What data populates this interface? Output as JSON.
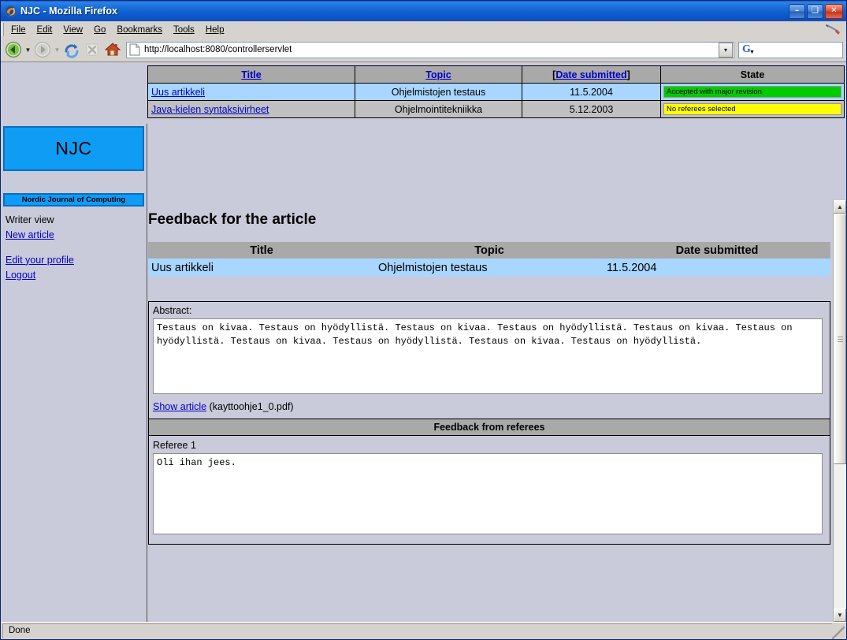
{
  "window": {
    "title": "NJC - Mozilla Firefox",
    "app_icon": "firefox-icon",
    "minimize_label": "–",
    "maximize_label": "❑",
    "close_label": "✕"
  },
  "menu": {
    "items": [
      "File",
      "Edit",
      "View",
      "Go",
      "Bookmarks",
      "Tools",
      "Help"
    ]
  },
  "toolbar": {
    "back_label": "Back",
    "forward_label": "Forward",
    "reload_label": "Reload",
    "stop_label": "Stop",
    "home_label": "Home",
    "url": "http://localhost:8080/controllerservlet",
    "url_placeholder": "Enter address",
    "go_label": "▾",
    "search_engine": "Google",
    "search_value": "",
    "search_placeholder": ""
  },
  "article_list": {
    "columns": [
      {
        "label": "Title",
        "link": true
      },
      {
        "label": "Topic",
        "link": true
      },
      {
        "label": "[Date submitted]",
        "link": true,
        "bracket_prefix": "[",
        "link_text": "Date submitted",
        "bracket_suffix": "]"
      },
      {
        "label": "State",
        "link": false
      }
    ],
    "rows": [
      {
        "title": "Uus artikkeli",
        "topic": "Ohjelmistojen testaus",
        "date": "11.5.2004",
        "state": "Accepted with major revision",
        "state_color": "#00cc00"
      },
      {
        "title": "Java-kielen syntaksivirheet",
        "topic": "Ohjelmointitekniikka",
        "date": "5.12.2003",
        "state": "No referees selected",
        "state_color": "#ffff00"
      }
    ]
  },
  "sidebar": {
    "logo_text": "NJC",
    "banner_text": "Nordic Journal of Computing",
    "view_label": "Writer view",
    "links": [
      {
        "label": "New article"
      },
      {
        "label": "Edit your profile"
      },
      {
        "label": "Logout"
      }
    ]
  },
  "main": {
    "heading": "Feedback for the article",
    "article_table": {
      "headers": [
        "Title",
        "Topic",
        "Date submitted"
      ],
      "row": {
        "title": "Uus artikkeli",
        "topic": "Ohjelmistojen testaus",
        "date": "11.5.2004"
      }
    },
    "abstract": {
      "label": "Abstract:",
      "text": "Testaus on kivaa. Testaus on hyödyllistä. Testaus on kivaa. Testaus on hyödyllistä. Testaus on kivaa. Testaus on hyödyllistä. Testaus on kivaa. Testaus on hyödyllistä. Testaus on kivaa. Testaus on hyödyllistä.",
      "show_article_link": "Show article",
      "file_name": "(kayttoohje1_0.pdf)"
    },
    "feedback": {
      "bar_title": "Feedback from referees",
      "referee_label": "Referee 1",
      "referee_text": "Oli ihan jees."
    }
  },
  "statusbar": {
    "text": "Done"
  }
}
